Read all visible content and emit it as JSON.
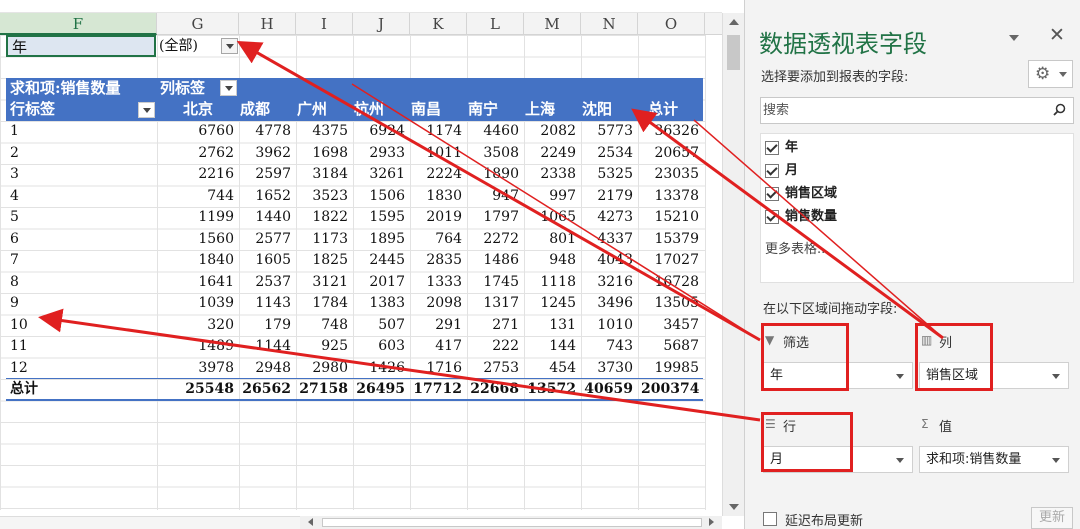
{
  "columns": [
    "F",
    "G",
    "H",
    "I",
    "J",
    "K",
    "L",
    "M",
    "N",
    "O"
  ],
  "filter": {
    "label": "年",
    "value": "(全部)"
  },
  "pivot": {
    "value_label": "求和项:销售数量",
    "column_label": "列标签",
    "row_label": "行标签",
    "cities": [
      "北京",
      "成都",
      "广州",
      "杭州",
      "南昌",
      "南宁",
      "上海",
      "沈阳",
      "总计"
    ],
    "rows": [
      {
        "label": "1",
        "values": [
          "6760",
          "4778",
          "4375",
          "6924",
          "1174",
          "4460",
          "2082",
          "5773",
          "36326"
        ]
      },
      {
        "label": "2",
        "values": [
          "2762",
          "3962",
          "1698",
          "2933",
          "1011",
          "3508",
          "2249",
          "2534",
          "20657"
        ]
      },
      {
        "label": "3",
        "values": [
          "2216",
          "2597",
          "3184",
          "3261",
          "2224",
          "1890",
          "2338",
          "5325",
          "23035"
        ]
      },
      {
        "label": "4",
        "values": [
          "744",
          "1652",
          "3523",
          "1506",
          "1830",
          "947",
          "997",
          "2179",
          "13378"
        ]
      },
      {
        "label": "5",
        "values": [
          "1199",
          "1440",
          "1822",
          "1595",
          "2019",
          "1797",
          "1065",
          "4273",
          "15210"
        ]
      },
      {
        "label": "6",
        "values": [
          "1560",
          "2577",
          "1173",
          "1895",
          "764",
          "2272",
          "801",
          "4337",
          "15379"
        ]
      },
      {
        "label": "7",
        "values": [
          "1840",
          "1605",
          "1825",
          "2445",
          "2835",
          "1486",
          "948",
          "4043",
          "17027"
        ]
      },
      {
        "label": "8",
        "values": [
          "1641",
          "2537",
          "3121",
          "2017",
          "1333",
          "1745",
          "1118",
          "3216",
          "16728"
        ]
      },
      {
        "label": "9",
        "values": [
          "1039",
          "1143",
          "1784",
          "1383",
          "2098",
          "1317",
          "1245",
          "3496",
          "13505"
        ]
      },
      {
        "label": "10",
        "values": [
          "320",
          "179",
          "748",
          "507",
          "291",
          "271",
          "131",
          "1010",
          "3457"
        ]
      },
      {
        "label": "11",
        "values": [
          "1489",
          "1144",
          "925",
          "603",
          "417",
          "222",
          "144",
          "743",
          "5687"
        ]
      },
      {
        "label": "12",
        "values": [
          "3978",
          "2948",
          "2980",
          "1426",
          "1716",
          "2753",
          "454",
          "3730",
          "19985"
        ]
      }
    ],
    "total": {
      "label": "总计",
      "values": [
        "25548",
        "26562",
        "27158",
        "26495",
        "17712",
        "22668",
        "13572",
        "40659",
        "200374"
      ]
    }
  },
  "pane": {
    "title": "数据透视表字段",
    "subtitle": "选择要添加到报表的字段:",
    "search_placeholder": "搜索",
    "fields": [
      "年",
      "月",
      "销售区域",
      "销售数量"
    ],
    "more_tables": "更多表格...",
    "drag_hint": "在以下区域间拖动字段:",
    "areas": {
      "filter": {
        "title": "筛选",
        "field": "年"
      },
      "columns": {
        "title": "列",
        "field": "销售区域"
      },
      "rows": {
        "title": "行",
        "field": "月"
      },
      "values": {
        "title": "值",
        "field": "求和项:销售数量"
      }
    },
    "defer_label": "延迟布局更新",
    "update_label": "更新"
  },
  "colors": {
    "accent_green": "#217346",
    "pivot_header": "#4472c4",
    "annotation_red": "#e02020"
  }
}
